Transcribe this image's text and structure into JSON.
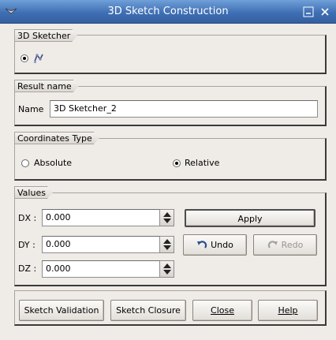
{
  "window": {
    "title": "3D Sketch Construction",
    "app_icon": "app-logo-icon",
    "minimize_icon": "minimize-icon",
    "close_icon": "close-icon"
  },
  "sketcher_group": {
    "title": "3D Sketcher",
    "radio_icon": "sketcher-3d-icon",
    "radio_checked": true
  },
  "result_group": {
    "title": "Result name",
    "name_label": "Name",
    "name_value": "3D Sketcher_2"
  },
  "coords_group": {
    "title": "Coordinates Type",
    "options": [
      {
        "label": "Absolute",
        "checked": false
      },
      {
        "label": "Relative",
        "checked": true
      }
    ]
  },
  "values_group": {
    "title": "Values",
    "fields": [
      {
        "label": "DX :",
        "value": "0.000"
      },
      {
        "label": "DY :",
        "value": "0.000"
      },
      {
        "label": "DZ :",
        "value": "0.000"
      }
    ],
    "apply_label": "Apply",
    "undo_label": "Undo",
    "undo_icon": "undo-icon",
    "redo_label": "Redo",
    "redo_icon": "redo-icon",
    "redo_enabled": false
  },
  "bottom_buttons": [
    {
      "label": "Sketch Validation"
    },
    {
      "label": "Sketch Closure"
    },
    {
      "label": "Close"
    },
    {
      "label": "Help"
    }
  ]
}
